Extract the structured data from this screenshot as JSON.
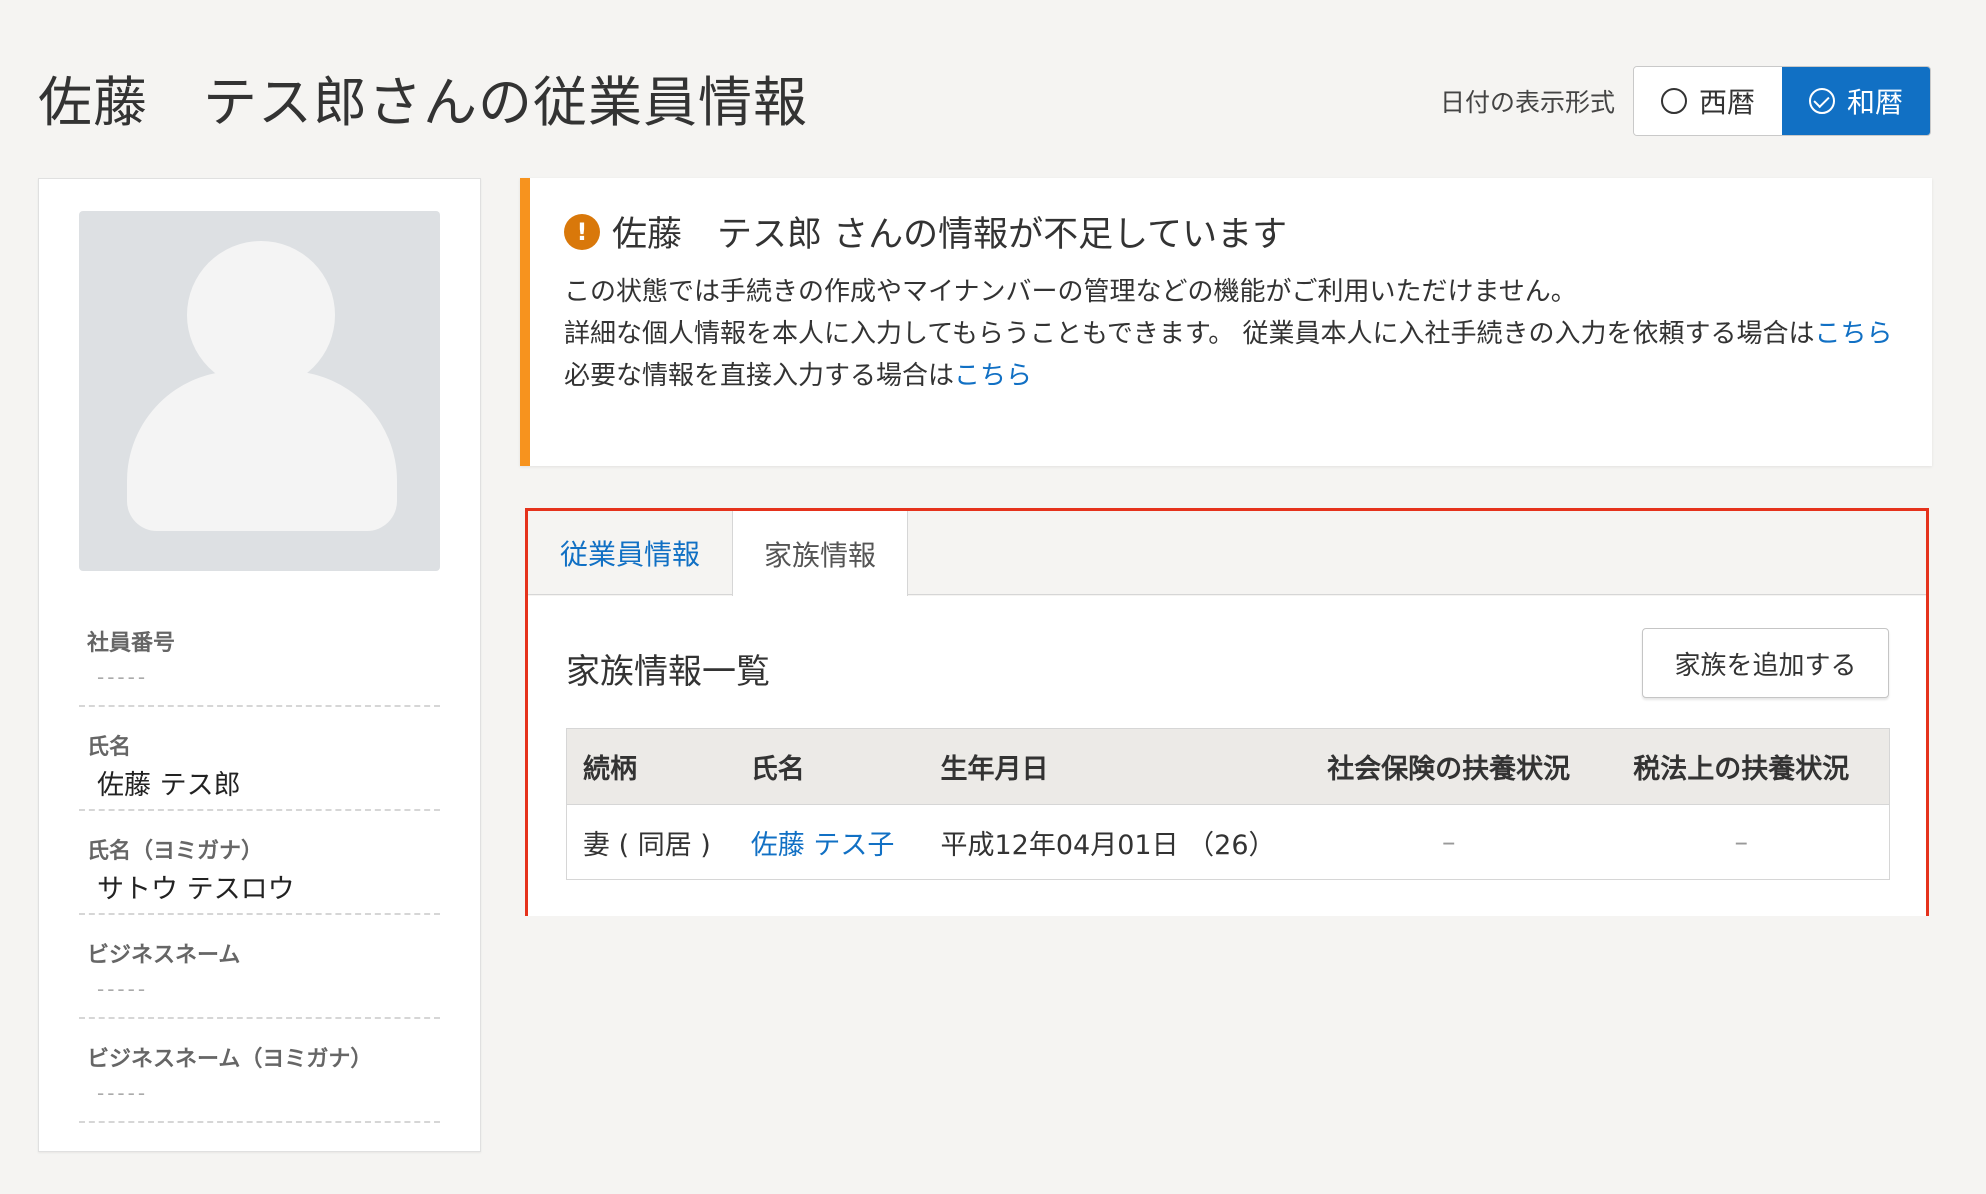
{
  "page": {
    "title": "佐藤　テス郎さんの従業員情報"
  },
  "date_format": {
    "label": "日付の表示形式",
    "options": [
      "西暦",
      "和暦"
    ],
    "selected": "和暦"
  },
  "profile": {
    "fields": [
      {
        "label": "社員番号",
        "value": "-----"
      },
      {
        "label": "氏名",
        "value": "佐藤 テス郎"
      },
      {
        "label": "氏名（ヨミガナ）",
        "value": "サトウ テスロウ"
      },
      {
        "label": "ビジネスネーム",
        "value": "-----"
      },
      {
        "label": "ビジネスネーム（ヨミガナ）",
        "value": "-----"
      }
    ]
  },
  "alert": {
    "title": "佐藤　テス郎 さんの情報が不足しています",
    "line1": "この状態では手続きの作成やマイナンバーの管理などの機能がご利用いただけません。",
    "line2": "詳細な個人情報を本人に入力してもらうこともできます。 従業員本人に入社手続きの入力を依頼する場合は",
    "line2_link": "こちら",
    "line3": "必要な情報を直接入力する場合は",
    "line3_link": "こちら"
  },
  "tabs": [
    {
      "label": "従業員情報",
      "active": false
    },
    {
      "label": "家族情報",
      "active": true
    }
  ],
  "family": {
    "section_title": "家族情報一覧",
    "add_button": "家族を追加する",
    "columns": [
      "続柄",
      "氏名",
      "生年月日",
      "社会保険の扶養状況",
      "税法上の扶養状況"
    ],
    "rows": [
      {
        "relation": "妻 ( 同居 )",
        "name": "佐藤 テス子",
        "birthdate": "平成12年04月01日 （26）",
        "social_insurance": "–",
        "tax": "–"
      }
    ]
  },
  "colors": {
    "accent": "#1170c4",
    "warning": "#f7931e",
    "highlight_border": "#e5321c"
  }
}
